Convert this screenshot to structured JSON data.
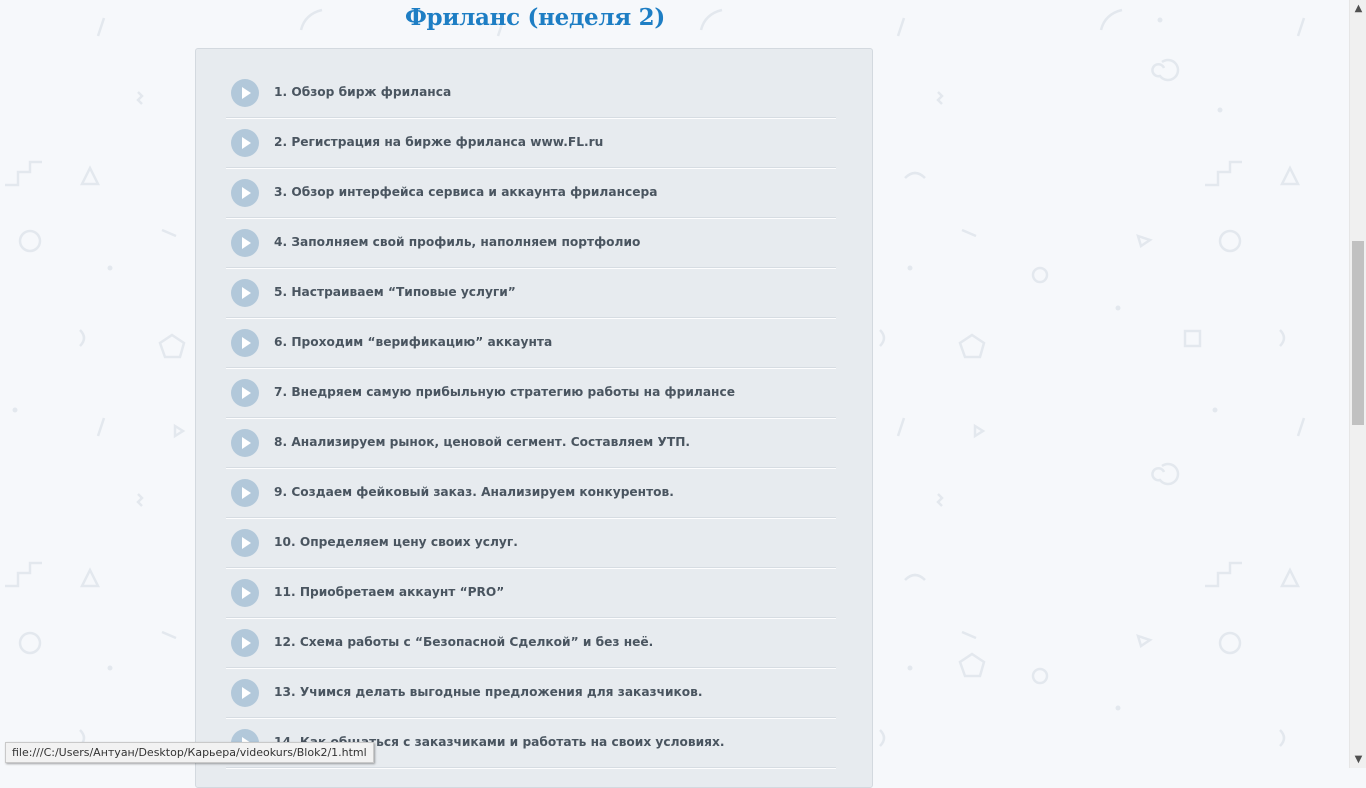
{
  "page": {
    "title": "Фриланс (неделя 2)"
  },
  "lessons": [
    {
      "label": "1. Обзор бирж фриланса"
    },
    {
      "label": "2. Регистрация на бирже фриланса www.FL.ru"
    },
    {
      "label": "3. Обзор интерфейса сервиса и аккаунта фрилансера"
    },
    {
      "label": "4. Заполняем свой профиль, наполняем портфолио"
    },
    {
      "label": "5. Настраиваем “Типовые услуги”"
    },
    {
      "label": "6. Проходим “верификацию” аккаунта"
    },
    {
      "label": "7. Внедряем самую прибыльную стратегию работы на фрилансе"
    },
    {
      "label": "8. Анализируем рынок, ценовой сегмент. Составляем УТП."
    },
    {
      "label": "9. Создаем фейковый заказ. Анализируем конкурентов."
    },
    {
      "label": "10. Определяем цену своих услуг."
    },
    {
      "label": "11. Приобретаем аккаунт “PRO”"
    },
    {
      "label": "12. Схема работы с “Безопасной Сделкой” и без неё."
    },
    {
      "label": "13. Учимся делать выгодные предложения для заказчиков."
    },
    {
      "label": "14. Как общаться с заказчиками и работать на своих условиях."
    }
  ],
  "status_bar": {
    "url": "file:///C:/Users/Антуан/Desktop/Карьера/videokurs/Blok2/1.html"
  },
  "scrollbar": {
    "up_arrow": "▲",
    "down_arrow": "▼",
    "position": 0.33
  },
  "colors": {
    "title": "#1e7ec4",
    "play_icon": "#b2c8da",
    "panel": "#e7ebef",
    "label": "#4a5560"
  },
  "icons": {
    "lesson": "play-icon"
  }
}
